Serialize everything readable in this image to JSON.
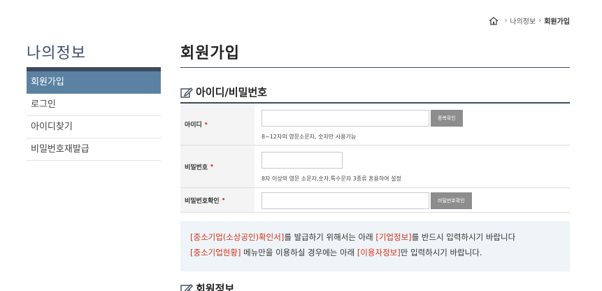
{
  "breadcrumb": {
    "items": [
      "나의정보",
      "회원가입"
    ]
  },
  "sidebar": {
    "title": "나의정보",
    "items": [
      {
        "label": "회원가입"
      },
      {
        "label": "로그인"
      },
      {
        "label": "아이디찾기"
      },
      {
        "label": "비밀번호재발급"
      }
    ]
  },
  "main": {
    "title": "회원가입",
    "section1": "아이디/비밀번호",
    "section2": "회원정보"
  },
  "form": {
    "id_label": "아이디",
    "id_check_button": "중복확인",
    "id_help": "8~12자의 영문소문자, 숫자만 사용가능",
    "pw_label": "비밀번호",
    "pw_help": "8자 이상의 영문 소문자,숫자,특수문자 3종류 혼용하여 설정",
    "pw_confirm_label": "비밀번호확인",
    "pw_confirm_button": "비밀번호확인",
    "required_mark": "•"
  },
  "notice": {
    "line1": {
      "a": "[중소기업(소상공인)확인서]",
      "b": "를 발급하기 위해서는 아래 ",
      "c": "[기업정보]",
      "d": "를 반드시 입력하시기 바랍니다"
    },
    "line2": {
      "a": "[중소기업현황]",
      "b": " 메뉴만을 이용하실 경우에는 아래 ",
      "c": "[이용자정보]",
      "d": "만 입력하시기 바랍니다."
    }
  },
  "colors": {
    "accent": "#5b82a3",
    "dark": "#3c4a5e",
    "required": "#e0402a",
    "highlight": "#d6331f",
    "notice_bg": "#eef4f7"
  }
}
